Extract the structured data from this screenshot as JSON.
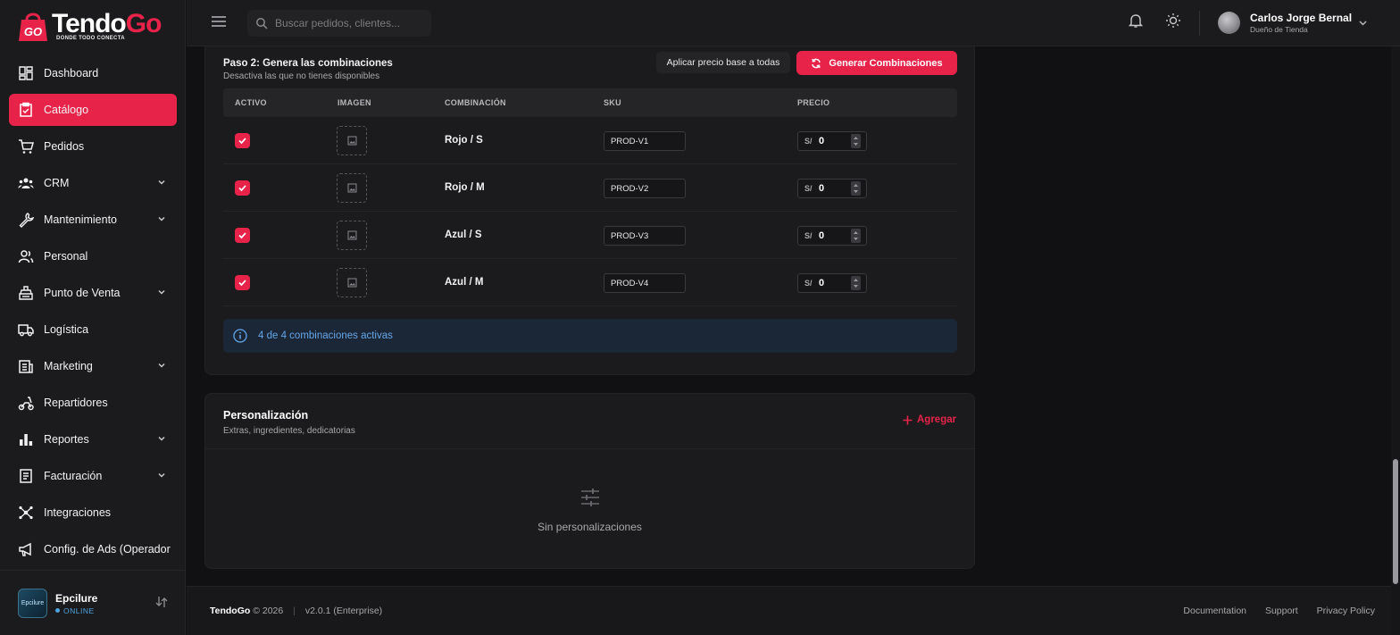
{
  "brand": {
    "name_part1": "Tendo",
    "name_part2": "Go",
    "tagline": "DONDE TODO CONECTA",
    "badge": "GO"
  },
  "search": {
    "placeholder": "Buscar pedidos, clientes..."
  },
  "user": {
    "name": "Carlos Jorge Bernal",
    "role": "Dueño de Tienda"
  },
  "sidebar": {
    "items": [
      {
        "label": "Dashboard",
        "icon": "dashboard-icon",
        "has_chevron": false,
        "active": false
      },
      {
        "label": "Catálogo",
        "icon": "catalog-icon",
        "has_chevron": false,
        "active": true
      },
      {
        "label": "Pedidos",
        "icon": "cart-icon",
        "has_chevron": false,
        "active": false
      },
      {
        "label": "CRM",
        "icon": "people-icon",
        "has_chevron": true,
        "active": false
      },
      {
        "label": "Mantenimiento",
        "icon": "wrench-icon",
        "has_chevron": true,
        "active": false
      },
      {
        "label": "Personal",
        "icon": "person-icon",
        "has_chevron": false,
        "active": false
      },
      {
        "label": "Punto de Venta",
        "icon": "register-icon",
        "has_chevron": true,
        "active": false
      },
      {
        "label": "Logística",
        "icon": "truck-icon",
        "has_chevron": false,
        "active": false
      },
      {
        "label": "Marketing",
        "icon": "newspaper-icon",
        "has_chevron": true,
        "active": false
      },
      {
        "label": "Repartidores",
        "icon": "scooter-icon",
        "has_chevron": false,
        "active": false
      },
      {
        "label": "Reportes",
        "icon": "bar-chart-icon",
        "has_chevron": true,
        "active": false
      },
      {
        "label": "Facturación",
        "icon": "invoice-icon",
        "has_chevron": true,
        "active": false
      },
      {
        "label": "Integraciones",
        "icon": "hub-icon",
        "has_chevron": false,
        "active": false
      },
      {
        "label": "Config. de Ads (Operador",
        "icon": "megaphone-icon",
        "has_chevron": false,
        "active": false
      }
    ],
    "store": {
      "name": "Epcilure",
      "status": "ONLINE",
      "avatar_text": "Epcilure"
    }
  },
  "combinations": {
    "title": "Paso 2: Genera las combinaciones",
    "subtitle": "Desactiva las que no tienes disponibles",
    "apply_base_label": "Aplicar precio base a todas",
    "generate_label": "Generar Combinaciones",
    "columns": [
      "ACTIVO",
      "IMAGEN",
      "COMBINACIÓN",
      "SKU",
      "PRECIO"
    ],
    "currency": "S/",
    "rows": [
      {
        "active": true,
        "combination": "Rojo / S",
        "sku": "PROD-V1",
        "price": "0"
      },
      {
        "active": true,
        "combination": "Rojo / M",
        "sku": "PROD-V2",
        "price": "0"
      },
      {
        "active": true,
        "combination": "Azul / S",
        "sku": "PROD-V3",
        "price": "0"
      },
      {
        "active": true,
        "combination": "Azul / M",
        "sku": "PROD-V4",
        "price": "0"
      }
    ],
    "summary": "4 de 4 combinaciones activas"
  },
  "personalization": {
    "title": "Personalización",
    "subtitle": "Extras, ingredientes, dedicatorias",
    "add_label": "Agregar",
    "empty_text": "Sin personalizaciones"
  },
  "footer": {
    "brand": "TendoGo",
    "copyright": "© 2026",
    "version": "v2.0.1 (Enterprise)",
    "links": [
      "Documentation",
      "Support",
      "Privacy Policy"
    ]
  },
  "colors": {
    "accent": "#e8234a",
    "info": "#64a7e8",
    "sidebar_bg": "#1b1b1d",
    "main_bg": "#111113"
  }
}
